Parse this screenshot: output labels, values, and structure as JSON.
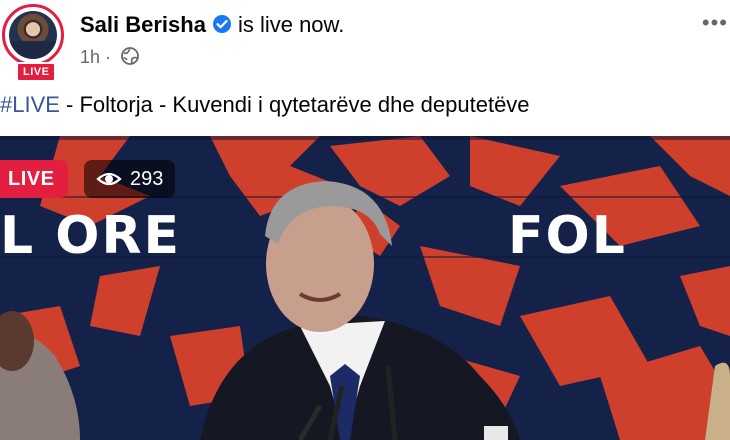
{
  "post": {
    "author": "Sali Berisha",
    "status_text": "is live now.",
    "time": "1h",
    "separator": "·",
    "avatar_badge": "LIVE",
    "more_icon": "more-horizontal-icon",
    "audience_icon": "globe-icon"
  },
  "caption": {
    "hashtag": "#LIVE",
    "text": " - Foltorja - Kuvendi i qytetarëve dhe deputetëve"
  },
  "video": {
    "live_label": "LIVE",
    "viewer_count": "293",
    "brand_left": "L ORE",
    "brand_right": "FOL",
    "colors": {
      "live_red": "#e41e3f",
      "backdrop_navy": "#0f1b3d",
      "pattern_red": "#d9412b"
    }
  }
}
